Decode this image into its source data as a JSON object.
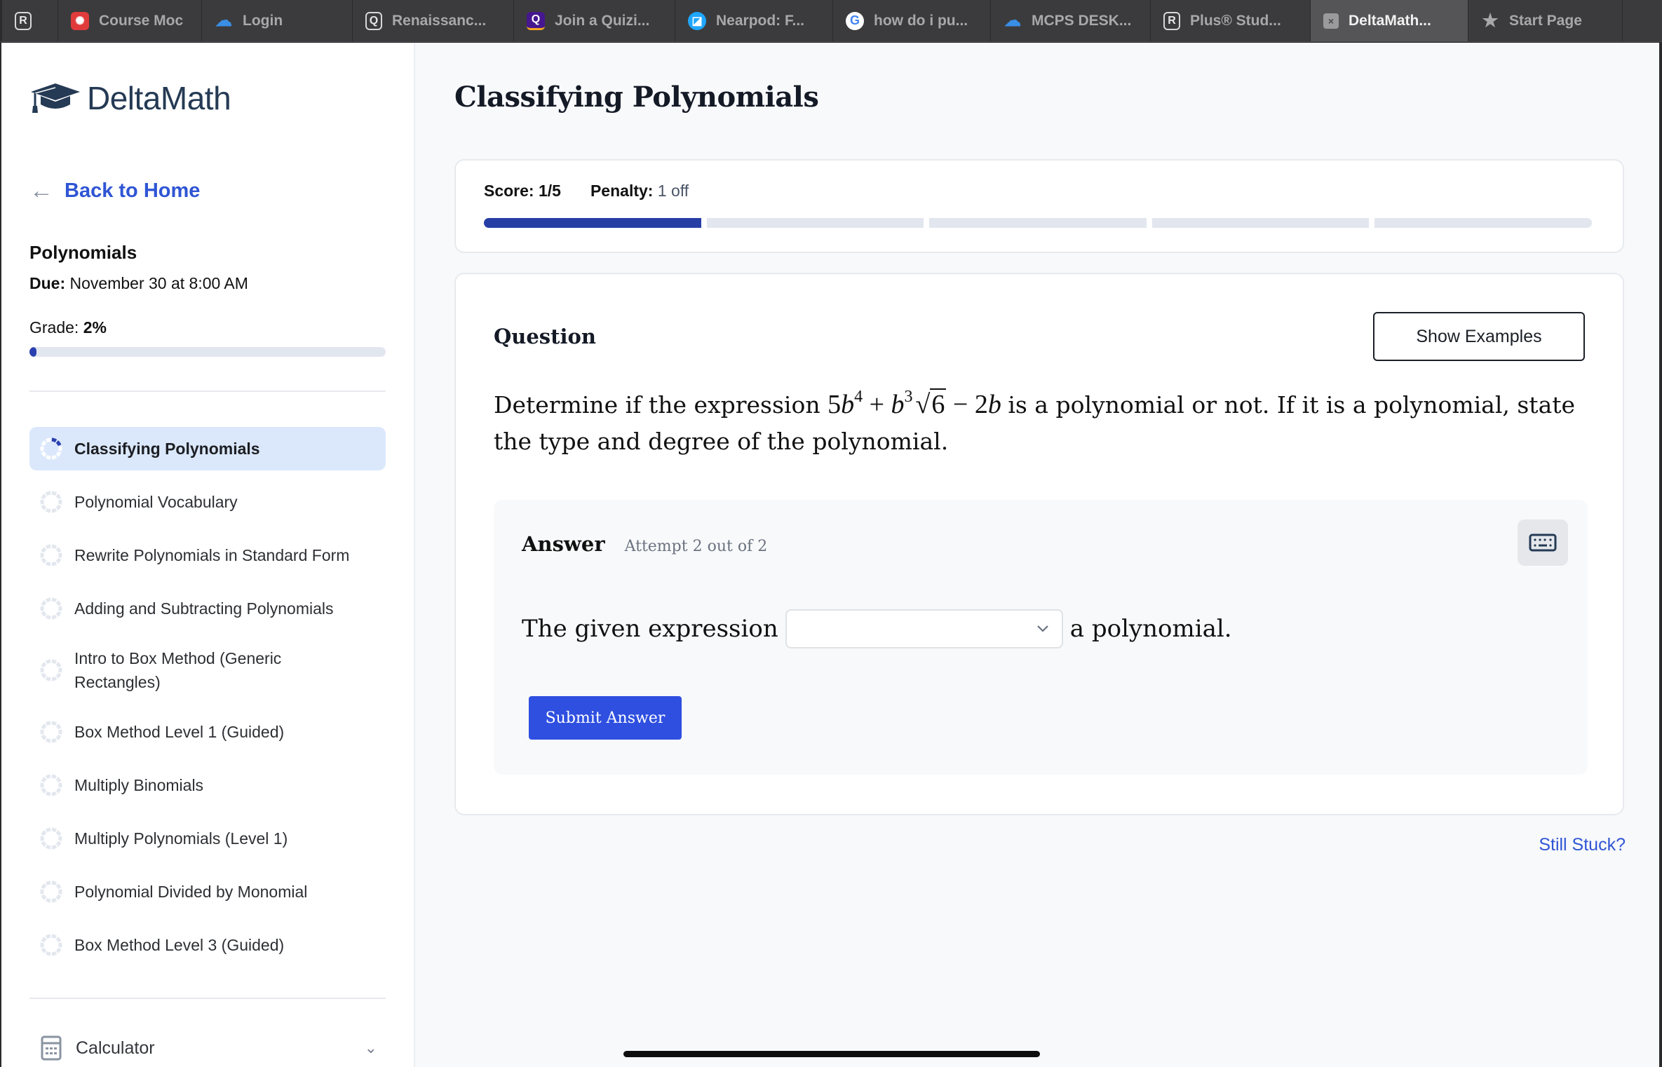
{
  "browser": {
    "tabs": [
      {
        "label": "",
        "icon": "r-letter-icon",
        "glyph": "R",
        "active": false
      },
      {
        "label": "Course Moc",
        "icon": "canvas-icon",
        "glyph": "✺",
        "active": false
      },
      {
        "label": "Login",
        "icon": "cloud-icon",
        "glyph": "☁",
        "active": false
      },
      {
        "label": "Renaissanc...",
        "icon": "q-letter-icon",
        "glyph": "Q",
        "active": false
      },
      {
        "label": "Join a Quizi...",
        "icon": "quizizz-icon",
        "glyph": "Q",
        "active": false
      },
      {
        "label": "Nearpod: F...",
        "icon": "nearpod-icon",
        "glyph": "◪",
        "active": false
      },
      {
        "label": "how do i pu...",
        "icon": "google-icon",
        "glyph": "G",
        "active": false
      },
      {
        "label": "MCPS DESK...",
        "icon": "cloud-icon",
        "glyph": "☁",
        "active": false
      },
      {
        "label": "Plus® Stud...",
        "icon": "r-letter-icon",
        "glyph": "R",
        "active": false
      },
      {
        "label": "DeltaMath...",
        "icon": "close-tab-icon",
        "glyph": "×",
        "active": true
      },
      {
        "label": "Start Page",
        "icon": "star-icon",
        "glyph": "★",
        "active": false
      }
    ]
  },
  "sidebar": {
    "logo_text": "DeltaMath",
    "back_label": "Back to Home",
    "assignment_title": "Polynomials",
    "due_label": "Due:",
    "due_value": "November 30 at 8:00 AM",
    "grade_label": "Grade:",
    "grade_value": "2%",
    "grade_fraction": 0.02,
    "skills": [
      {
        "label": "Classifying Polynomials",
        "active": true,
        "progress": 0.2
      },
      {
        "label": "Polynomial Vocabulary",
        "active": false,
        "progress": 0
      },
      {
        "label": "Rewrite Polynomials in Standard Form",
        "active": false,
        "progress": 0
      },
      {
        "label": "Adding and Subtracting Polynomials",
        "active": false,
        "progress": 0
      },
      {
        "label": "Intro to Box Method (Generic Rectangles)",
        "active": false,
        "progress": 0
      },
      {
        "label": "Box Method Level 1 (Guided)",
        "active": false,
        "progress": 0
      },
      {
        "label": "Multiply Binomials",
        "active": false,
        "progress": 0
      },
      {
        "label": "Multiply Polynomials (Level 1)",
        "active": false,
        "progress": 0
      },
      {
        "label": "Polynomial Divided by Monomial",
        "active": false,
        "progress": 0
      },
      {
        "label": "Box Method Level 3 (Guided)",
        "active": false,
        "progress": 0
      }
    ],
    "calculator_label": "Calculator"
  },
  "main": {
    "title": "Classifying Polynomials",
    "score_label": "Score:",
    "score_value": "1/5",
    "score_completed": 1,
    "score_total": 5,
    "penalty_label": "Penalty:",
    "penalty_value": "1 off",
    "question_label": "Question",
    "show_examples_label": "Show Examples",
    "question_before": "Determine if the expression",
    "question_after": "is a polynomial or not. If it is a polynomial, state the type and degree of the polynomial.",
    "expression": {
      "t1_coef": "5",
      "t1_var": "b",
      "t1_exp": "4",
      "op1": "+",
      "t2_var": "b",
      "t2_exp": "3",
      "t2_radicand": "6",
      "op2": "−",
      "t3_coef": "2",
      "t3_var": "b"
    },
    "answer_label": "Answer",
    "attempt_text": "Attempt 2 out of 2",
    "answer_prefix": "The given expression",
    "answer_select_value": "",
    "answer_suffix": "a polynomial.",
    "submit_label": "Submit Answer",
    "still_stuck_label": "Still Stuck?"
  },
  "colors": {
    "accent_blue": "#2e4fe0",
    "progress_navy": "#273ea5",
    "link_blue": "#2f55d4",
    "active_item_bg": "#dbe8fc"
  }
}
